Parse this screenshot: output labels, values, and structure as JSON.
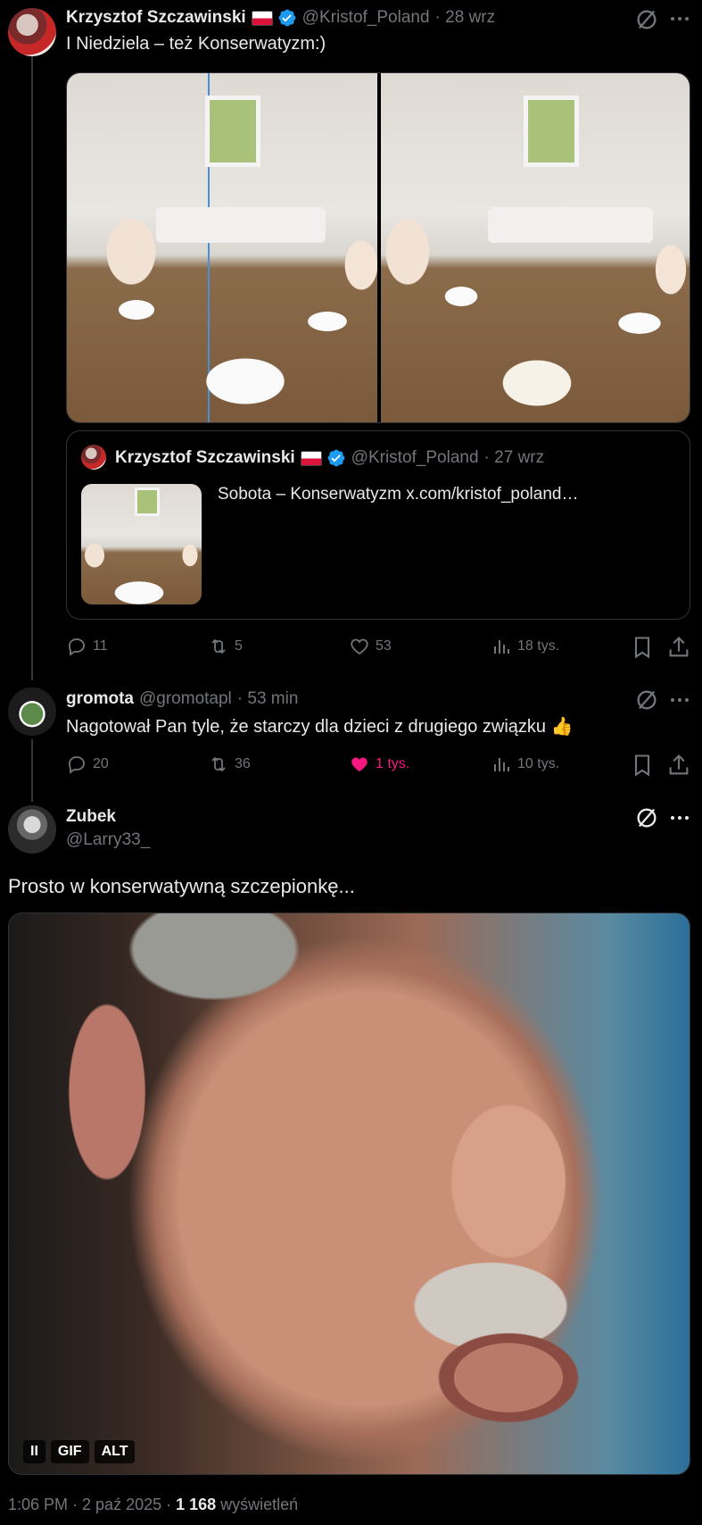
{
  "tweet1": {
    "name": "Krzysztof Szczawinski",
    "handle": "@Kristof_Poland",
    "time": "· 28 wrz",
    "text": "I Niedziela – też Konserwatyzm:)",
    "quote": {
      "name": "Krzysztof Szczawinski",
      "handle": "@Kristof_Poland",
      "time": "· 27 wrz",
      "text": "Sobota – Konserwatyzm  x.com/kristof_poland…"
    },
    "stats": {
      "replies": "11",
      "reposts": "5",
      "likes": "53",
      "views": "18 tys."
    }
  },
  "tweet2": {
    "name": "gromota",
    "handle": "@gromotapl",
    "time": "· 53 min",
    "text": "Nagotował Pan tyle, że starczy dla dzieci z drugiego związku",
    "emoji": "👍",
    "stats": {
      "replies": "20",
      "reposts": "36",
      "likes": "1 tys.",
      "views": "10 tys."
    }
  },
  "tweet3": {
    "name": "Zubek",
    "handle": "@Larry33_",
    "text": "Prosto w konserwatywną szczepionkę...",
    "gif": {
      "pause": "II",
      "gif_label": "GIF",
      "alt_label": "ALT"
    }
  },
  "footer": {
    "time": "1:06 PM · 2 paź 2025 · ",
    "views_count": "1 168",
    "views_label": " wyświetleń"
  },
  "icons": {
    "reply": "reply-icon",
    "repost": "repost-icon",
    "like": "heart-icon",
    "views": "views-icon",
    "bookmark": "bookmark-icon",
    "share": "share-icon",
    "grok": "grok-icon",
    "more": "more-icon"
  },
  "colors": {
    "accent": "#1d9bf0",
    "like": "#f91880",
    "muted": "#71767b"
  }
}
